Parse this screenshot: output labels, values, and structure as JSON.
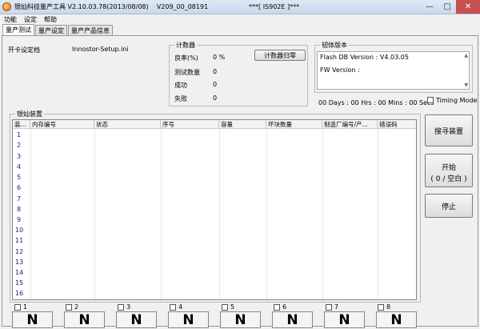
{
  "window": {
    "title": "银灿科技量产工具 V2.10.03.78(2013/08/08)    V209_00_08191                    ***[ IS902E ]***",
    "min": "—",
    "max": "□",
    "close": "✕"
  },
  "menu": [
    "功能",
    "设定",
    "帮助"
  ],
  "tabs": [
    "量产测试",
    "量产设定",
    "量产产品信息"
  ],
  "settings": {
    "label": "开卡设定档",
    "file": "Innostor-Setup.ini"
  },
  "counter": {
    "title": "计数器",
    "rows": [
      {
        "label": "良率(%)",
        "value": "0 %"
      },
      {
        "label": "测试数量",
        "value": "0"
      },
      {
        "label": "成功",
        "value": "0"
      },
      {
        "label": "失败",
        "value": "0"
      }
    ],
    "reset_button": "计数器归零"
  },
  "firmware": {
    "title": "韧体版本",
    "flash_db": "Flash DB Version :   V4.03.05",
    "fw": "FW Version :"
  },
  "timer": "00 Days : 00 Hrs : 00 Mins : 00 Secs",
  "timing_mode": "Timing Mode",
  "devices": {
    "title": "银灿装置",
    "columns": [
      "装...",
      "内存编号",
      "状态",
      "序号",
      "容量",
      "坏块数量",
      "制造厂编号/产...",
      "错误码"
    ],
    "rows": [
      "1",
      "2",
      "3",
      "4",
      "5",
      "6",
      "7",
      "8",
      "9",
      "10",
      "11",
      "12",
      "13",
      "14",
      "15",
      "16"
    ]
  },
  "buttons": {
    "search": "搜寻装置",
    "start": "开始",
    "start_sub": "( 0 / 空白 )",
    "stop": "停止"
  },
  "ports": [
    {
      "num": "1",
      "status": "N"
    },
    {
      "num": "2",
      "status": "N"
    },
    {
      "num": "3",
      "status": "N"
    },
    {
      "num": "4",
      "status": "N"
    },
    {
      "num": "5",
      "status": "N"
    },
    {
      "num": "6",
      "status": "N"
    },
    {
      "num": "7",
      "status": "N"
    },
    {
      "num": "8",
      "status": "N"
    }
  ]
}
